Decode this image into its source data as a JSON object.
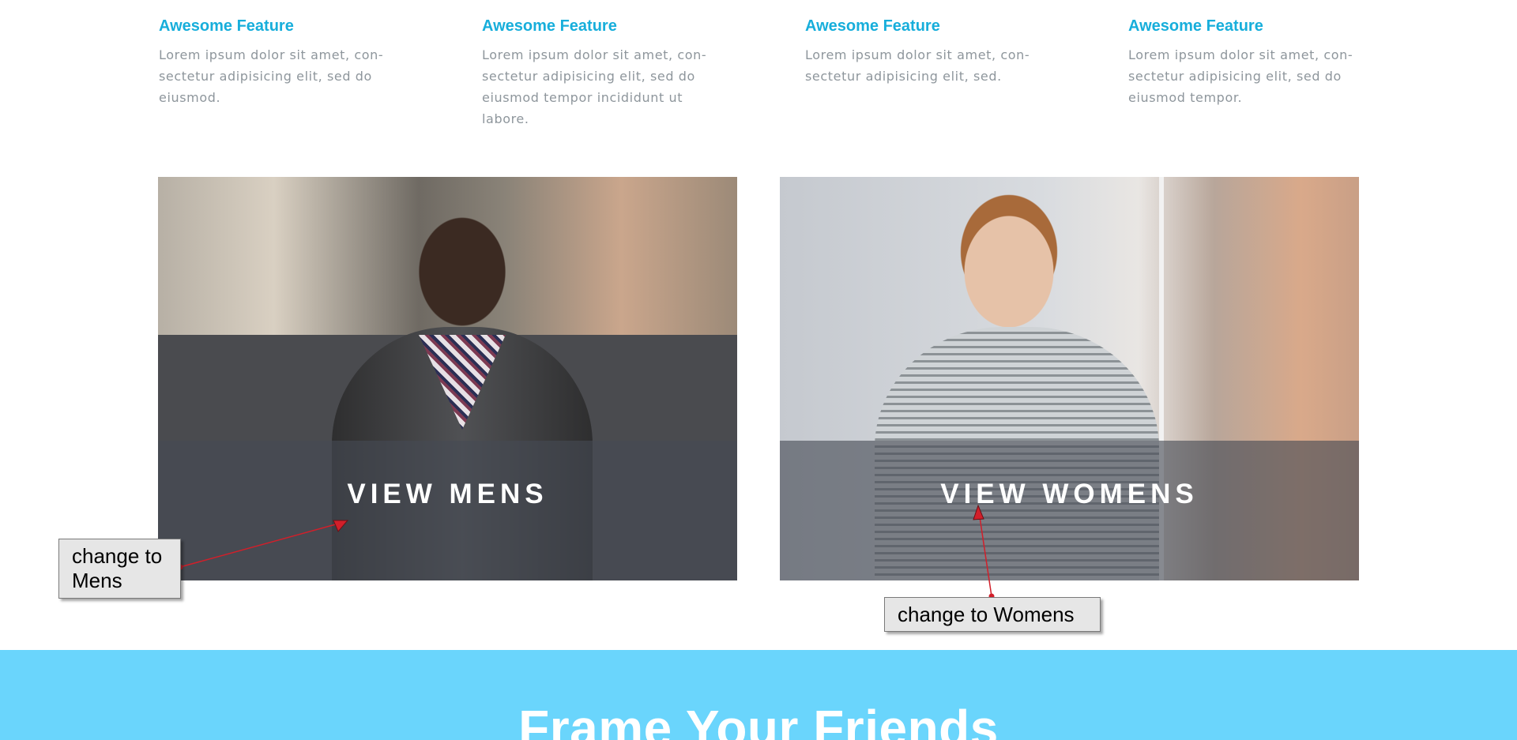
{
  "features": [
    {
      "title": "Awesome Feature",
      "text": "Lorem ipsum dolor sit amet, con-sectetur adipisicing elit, sed do eiusmod."
    },
    {
      "title": "Awesome Feature",
      "text": "Lorem ipsum dolor sit amet, con-sectetur adipisicing elit, sed do eiusmod tempor incididunt ut labore."
    },
    {
      "title": "Awesome Feature",
      "text": "Lorem ipsum dolor sit amet, con-sectetur adipisicing elit, sed."
    },
    {
      "title": "Awesome Feature",
      "text": "Lorem ipsum dolor sit amet, con-sectetur adipisicing elit, sed do eiusmod tempor."
    }
  ],
  "panels": {
    "men": {
      "label": "VIEW MENS",
      "icon": "man-photo"
    },
    "women": {
      "label": "VIEW WOMENS",
      "icon": "woman-photo"
    }
  },
  "annotations": {
    "mens": "change to Mens",
    "womens": "change to Womens"
  },
  "banner": {
    "title": "Frame Your Friends"
  },
  "colors": {
    "feature_title": "#17aedb",
    "feature_text": "#8e969c",
    "banner_bg": "#6ad5fc",
    "annotation_arrow": "#d21f2a"
  }
}
